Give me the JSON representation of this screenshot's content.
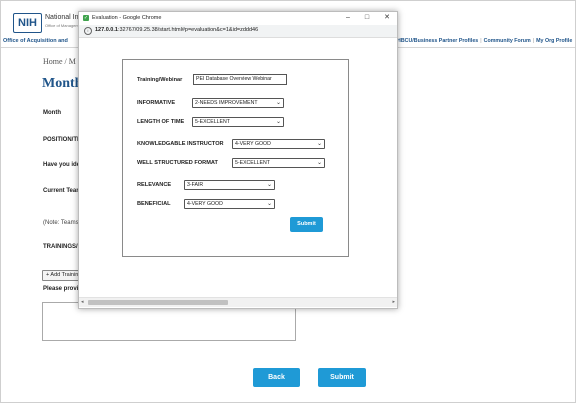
{
  "background": {
    "logo": "NIH",
    "org_name": "National Institu",
    "org_sub": "Office of Managem",
    "nav_left": "Office of Acquisition and",
    "nav_right": [
      "HBCU/Business Partner Profiles",
      "Community Forum",
      "My Org Profile"
    ],
    "breadcrumb": "Home  /  M",
    "page_title": "Month",
    "labels": {
      "month": "Month",
      "position": "POSITION/TI",
      "have_you": "Have you ide",
      "current_team": "Current Tean",
      "note": "(Note: Teams",
      "trainings": "TRAININGS/",
      "add_training": "+ Add Training",
      "please": "Please provi"
    },
    "buttons": {
      "back": "Back",
      "submit": "Submit"
    }
  },
  "popup": {
    "window_title": "Evaluation - Google Chrome",
    "controls": {
      "minimize": "–",
      "maximize": "□",
      "close": "✕"
    },
    "address": {
      "host": "127.0.0.1",
      "path": ":32767/09.25.38/start.html#p=evaluation&c=1&id=zddd46"
    },
    "form": {
      "training_label": "Training/Webinar",
      "training_value": "PEI Database Overview Webinar",
      "fields": [
        {
          "label": "INFORMATIVE",
          "value": "2-NEEDS IMPROVEMENT"
        },
        {
          "label": "LENGTH OF TIME",
          "value": "5-EXCELLENT"
        },
        {
          "label": "KNOWLEDGABLE INSTRUCTOR",
          "value": "4-VERY GOOD"
        },
        {
          "label": "WELL STRUCTURED FORMAT",
          "value": "5-EXCELLENT"
        },
        {
          "label": "RELEVANCE",
          "value": "3-FAIR"
        },
        {
          "label": "BENEFICIAL",
          "value": "4-VERY GOOD"
        }
      ],
      "submit_label": "Submit"
    }
  }
}
